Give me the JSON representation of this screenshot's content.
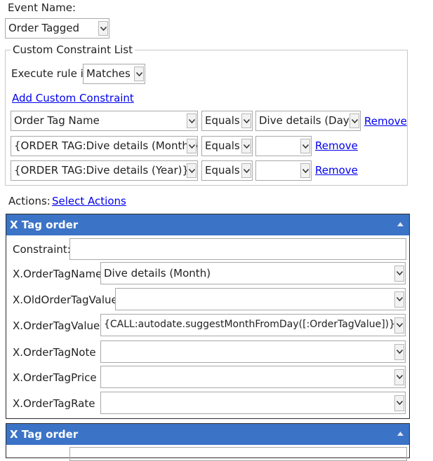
{
  "event": {
    "label": "Event Name:",
    "value": "Order Tagged"
  },
  "constraint_list": {
    "legend": "Custom Constraint List",
    "execute_label": "Execute rule if",
    "execute_value": "Matches",
    "add_link": "Add Custom Constraint",
    "rows": [
      {
        "field": "Order Tag Name",
        "op": "Equals",
        "value": "Dive details (Day)",
        "remove": "Remove"
      },
      {
        "field": "{ORDER TAG:Dive details (Month)}",
        "op": "Equals",
        "value": "",
        "remove": "Remove"
      },
      {
        "field": "{ORDER TAG:Dive details (Year)}",
        "op": "Equals",
        "value": "",
        "remove": "Remove"
      }
    ]
  },
  "actions": {
    "label": "Actions:",
    "select_link": "Select Actions"
  },
  "panels": [
    {
      "title": "X Tag order",
      "constraint_label": "Constraint:",
      "constraint_value": "",
      "fields": [
        {
          "label": "X.OrderTagName",
          "value": "Dive details (Month)"
        },
        {
          "label": "X.OldOrderTagValue",
          "value": ""
        },
        {
          "label": "X.OrderTagValue",
          "value": "{CALL:autodate.suggestMonthFromDay([:OrderTagValue])}"
        },
        {
          "label": "X.OrderTagNote",
          "value": ""
        },
        {
          "label": "X.OrderTagPrice",
          "value": ""
        },
        {
          "label": "X.OrderTagRate",
          "value": ""
        }
      ]
    },
    {
      "title": "X Tag order"
    }
  ],
  "colors": {
    "panel_header": "#3b73c6",
    "link": "#0000ee"
  },
  "icons": {
    "dropdown": "chevron-down-icon",
    "collapse": "caret-up-icon"
  }
}
